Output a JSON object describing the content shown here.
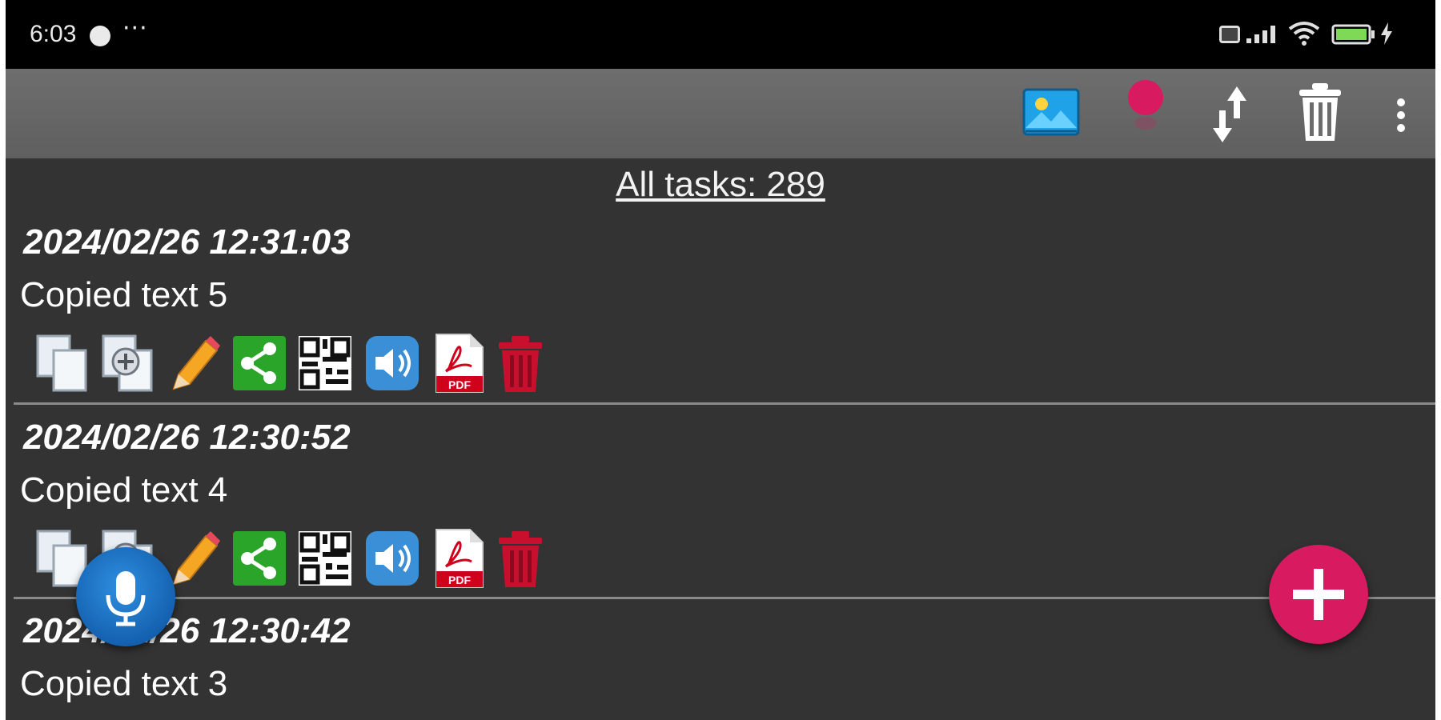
{
  "status_bar": {
    "time": "6:03",
    "more": "···"
  },
  "toolbar": {
    "icons": [
      "image-icon",
      "record-dot-icon",
      "sort-arrows-icon",
      "trash-icon",
      "overflow-menu-icon"
    ]
  },
  "list": {
    "header": "All tasks: 289",
    "tasks": [
      {
        "date": "2024/02/26 12:31:03",
        "text": "Copied text 5"
      },
      {
        "date": "2024/02/26 12:30:52",
        "text": "Copied text 4"
      },
      {
        "date": "2024/02/26 12:30:42",
        "text": "Copied text 3"
      }
    ],
    "actions": [
      "copy-icon",
      "copy-add-icon",
      "edit-pencil-icon",
      "share-icon",
      "qr-code-icon",
      "speaker-icon",
      "pdf-icon",
      "delete-icon"
    ]
  },
  "colors": {
    "background": "#333333",
    "toolbar": "#666666",
    "accent_pink": "#d81b60",
    "mic_blue": "#1f75c9",
    "share_green": "#2aa52a",
    "delete_red": "#c8102e"
  }
}
